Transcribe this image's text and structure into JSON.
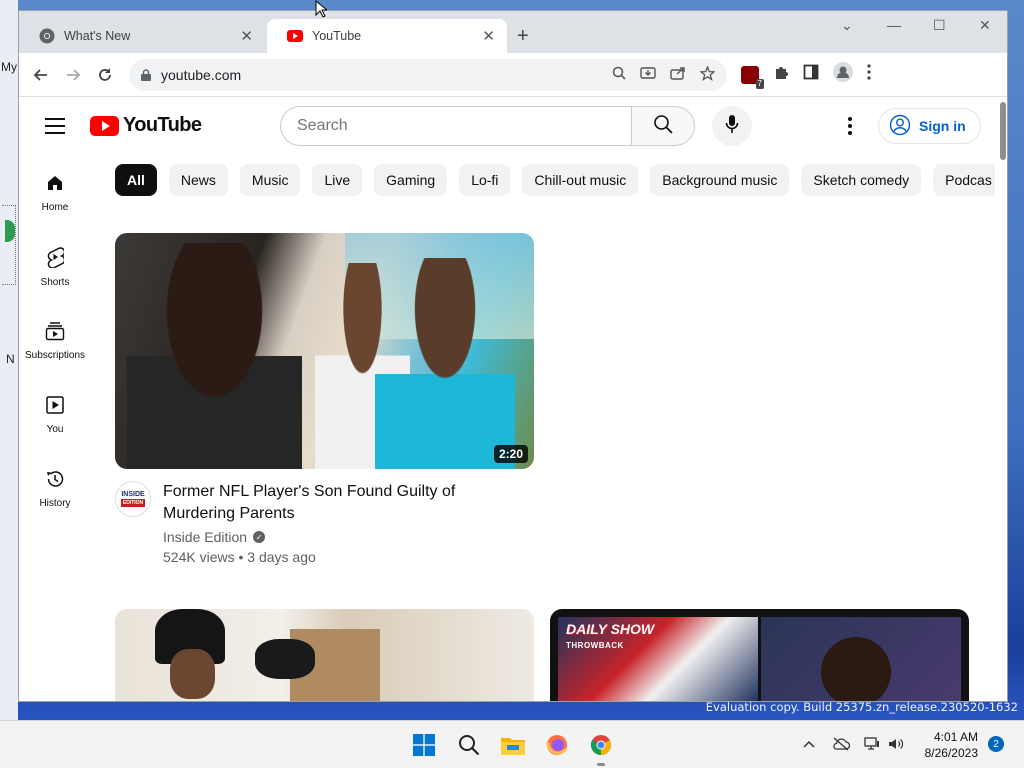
{
  "desktop": {
    "label_my": "My",
    "label_n": "N",
    "watermark": "Evaluation copy. Build 25375.zn_release.230520-1632"
  },
  "browser": {
    "tabs": [
      {
        "title": "What's New",
        "icon": "chrome-icon",
        "active": false
      },
      {
        "title": "YouTube",
        "icon": "youtube-favicon",
        "active": true
      }
    ],
    "url": "youtube.com",
    "extension_badge": "7"
  },
  "youtube": {
    "logo_text": "YouTube",
    "search_placeholder": "Search",
    "sign_in": "Sign in",
    "guide": [
      {
        "label": "Home",
        "icon": "home-icon"
      },
      {
        "label": "Shorts",
        "icon": "shorts-icon"
      },
      {
        "label": "Subscriptions",
        "icon": "subscriptions-icon"
      },
      {
        "label": "You",
        "icon": "you-icon"
      },
      {
        "label": "History",
        "icon": "history-icon"
      }
    ],
    "chips": [
      "All",
      "News",
      "Music",
      "Live",
      "Gaming",
      "Lo-fi",
      "Chill-out music",
      "Background music",
      "Sketch comedy",
      "Podcas"
    ],
    "video": {
      "title": "Former NFL Player's Son Found Guilty of Murdering Parents",
      "channel": "Inside Edition",
      "channel_avatar_text": "INSIDE",
      "channel_avatar_sub": "EDITION",
      "stats": "524K views • 3 days ago",
      "duration": "2:20"
    },
    "thumb3_logo": "DAILY SHOW",
    "thumb3_logo_sub": "THROWBACK"
  },
  "taskbar": {
    "time": "4:01 AM",
    "date": "8/26/2023",
    "notification_count": "2"
  },
  "colors": {
    "yt_red": "#ff0000",
    "link_blue": "#065fd4",
    "chip_active": "#0f0f0f"
  }
}
